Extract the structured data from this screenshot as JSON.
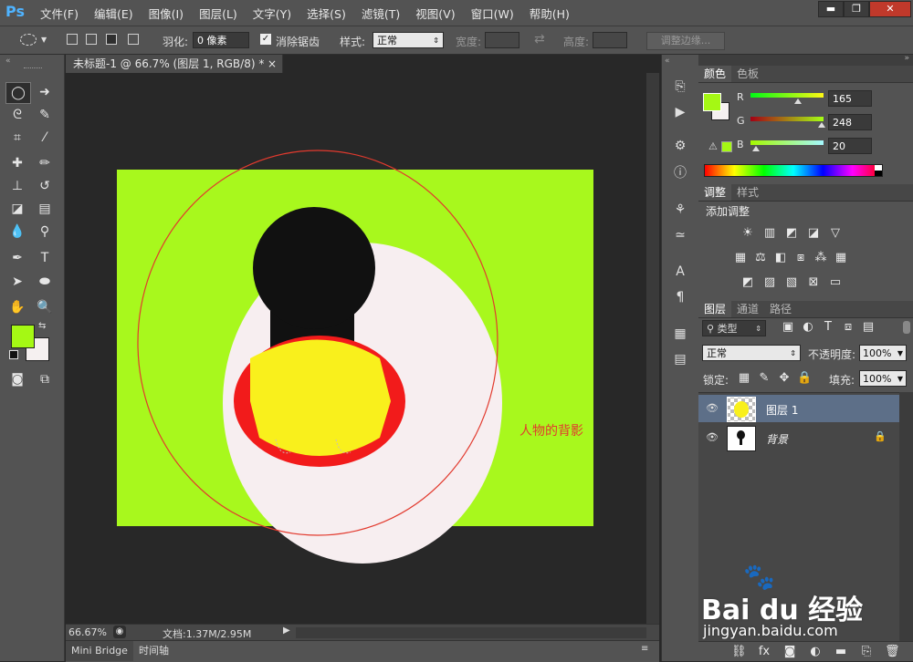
{
  "app": {
    "logo": "Ps"
  },
  "menu": [
    "文件(F)",
    "编辑(E)",
    "图像(I)",
    "图层(L)",
    "文字(Y)",
    "选择(S)",
    "滤镜(T)",
    "视图(V)",
    "窗口(W)",
    "帮助(H)"
  ],
  "window_buttons": {
    "minimize": "▬",
    "restore": "❐",
    "close": "✕"
  },
  "options": {
    "feather_label": "羽化:",
    "feather_value": "0 像素",
    "antialias_label": "消除锯齿",
    "antialias_checked": true,
    "style_label": "样式:",
    "style_value": "正常",
    "width_label": "宽度:",
    "height_label": "高度:",
    "refine_edge": "调整边缘..."
  },
  "document": {
    "tab_title": "未标题-1 @ 66.7% (图层 1, RGB/8) *",
    "close": "×",
    "annotation": "人物的背影",
    "zoom": "66.67%",
    "doc_size": "文档:1.37M/2.95M",
    "colors": {
      "background": "#a8f81d",
      "oval": "#f7eef0",
      "head": "#111111",
      "body": "#f9f01c",
      "sides": "#f21b1b",
      "selection": "#e23a2e"
    }
  },
  "bottom_tabs": [
    "Mini Bridge",
    "时间轴"
  ],
  "color_panel": {
    "tabs": [
      "颜色",
      "色板"
    ],
    "channels": [
      {
        "label": "R",
        "value": "165",
        "fraction": 0.647
      },
      {
        "label": "G",
        "value": "248",
        "fraction": 0.973
      },
      {
        "label": "B",
        "value": "20",
        "fraction": 0.078
      }
    ],
    "foreground": "#a5f814",
    "background": "#f5f0f0"
  },
  "adjustments_panel": {
    "tabs": [
      "调整",
      "样式"
    ],
    "title": "添加调整"
  },
  "layers_panel": {
    "tabs": [
      "图层",
      "通道",
      "路径"
    ],
    "filter_kind": "类型",
    "blend_mode": "正常",
    "opacity_label": "不透明度:",
    "opacity_value": "100%",
    "lock_label": "锁定:",
    "fill_label": "填充:",
    "fill_value": "100%",
    "layers": [
      {
        "name": "图层 1",
        "selected": true
      },
      {
        "name": "背景",
        "selected": false,
        "locked": true
      }
    ]
  },
  "watermark": {
    "brand": "Bai du 经验",
    "url": "jingyan.baidu.com"
  }
}
